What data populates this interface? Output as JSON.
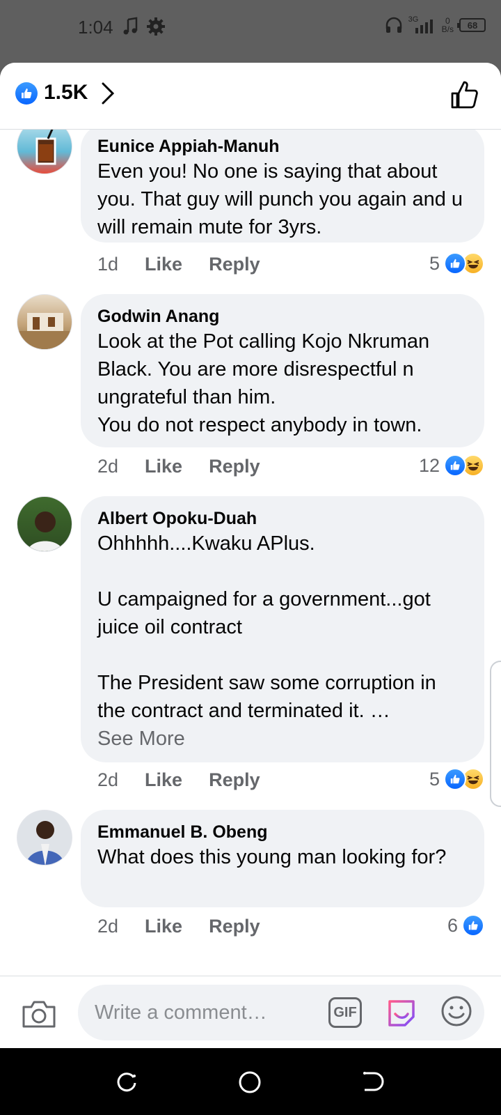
{
  "status_bar": {
    "time": "1:04",
    "network": "3G",
    "speed_value": "0",
    "speed_unit": "B/s",
    "battery": "68"
  },
  "header": {
    "like_count": "1.5K"
  },
  "comments": [
    {
      "author": "Eunice Appiah-Manuh",
      "text": "Even you! No one is saying that about you. That guy will punch you again and u will remain mute for 3yrs.",
      "time": "1d",
      "like_label": "Like",
      "reply_label": "Reply",
      "reaction_count": "5",
      "reactions": [
        "like-icon",
        "haha-icon"
      ]
    },
    {
      "author": "Godwin Anang",
      "text": "Look at the Pot calling Kojo Nkruman Black. You are more disrespectful n ungrateful than him.\nYou do not respect anybody in town.",
      "time": "2d",
      "like_label": "Like",
      "reply_label": "Reply",
      "reaction_count": "12",
      "reactions": [
        "like-icon",
        "haha-icon"
      ]
    },
    {
      "author": "Albert Opoku-Duah",
      "text": "Ohhhhh....Kwaku APlus.\n\nU campaigned for a government...got juice oil contract\n\nThe President saw some corruption in the contract and terminated it. …",
      "see_more": "See More",
      "time": "2d",
      "like_label": "Like",
      "reply_label": "Reply",
      "reaction_count": "5",
      "reactions": [
        "like-icon",
        "haha-icon"
      ]
    },
    {
      "author": "Emmanuel B. Obeng",
      "text": "What does this young man looking for?",
      "time": "2d",
      "like_label": "Like",
      "reply_label": "Reply",
      "reaction_count": "6",
      "reactions": [
        "like-icon"
      ]
    }
  ],
  "composer": {
    "placeholder": "Write a comment…",
    "gif_label": "GIF"
  },
  "colors": {
    "accent": "#0866ff",
    "bubble": "#f0f2f5",
    "meta": "#65676b"
  }
}
